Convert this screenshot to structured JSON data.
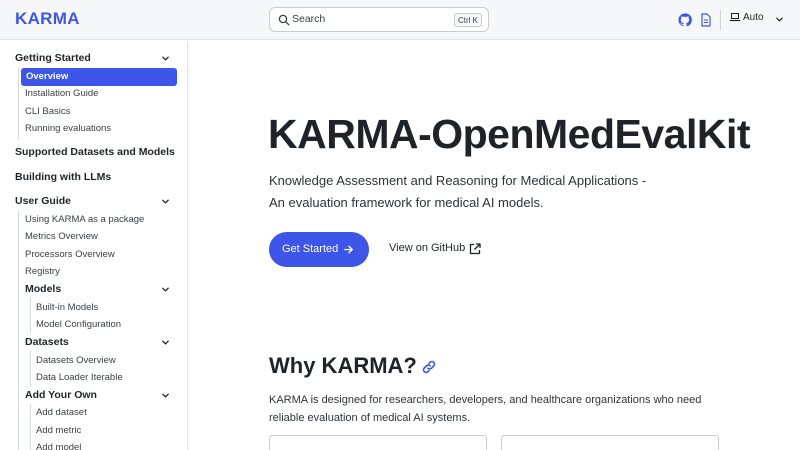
{
  "header": {
    "brand": "KARMA",
    "search_placeholder": "Search",
    "search_shortcut": "Ctrl K",
    "theme_label": "Auto",
    "icons": [
      "search-icon",
      "github-icon",
      "document-icon",
      "laptop-icon",
      "chevron-down-icon"
    ]
  },
  "sidebar": {
    "getting_started": "Getting Started",
    "overview": "Overview",
    "installation_guide": "Installation Guide",
    "cli_basics": "CLI Basics",
    "running_evaluations": "Running evaluations",
    "supported_datasets": "Supported Datasets and Models",
    "building_with_llms": "Building with LLMs",
    "user_guide": "User Guide",
    "using_karma_package": "Using KARMA as a package",
    "metrics_overview": "Metrics Overview",
    "processors_overview": "Processors Overview",
    "registry": "Registry",
    "models": "Models",
    "builtin_models": "Built-in Models",
    "model_configuration": "Model Configuration",
    "datasets": "Datasets",
    "datasets_overview": "Datasets Overview",
    "data_loader_iterable": "Data Loader Iterable",
    "add_your_own": "Add Your Own",
    "add_dataset": "Add dataset",
    "add_metric": "Add metric",
    "add_model": "Add model"
  },
  "hero": {
    "title": "KARMA-OpenMedEvalKit",
    "subtitle_line1": "Knowledge Assessment and Reasoning for Medical Applications -",
    "subtitle_line2": "An evaluation framework for medical AI models.",
    "primary_button": "Get Started",
    "secondary_button": "View on GitHub"
  },
  "why": {
    "heading": "Why KARMA?",
    "text_line1": "KARMA is designed for researchers, developers, and healthcare organizations who need",
    "text_line2": "reliable evaluation of medical AI systems."
  },
  "colors": {
    "accent": "#3d55e8",
    "text": "#1f2328",
    "header_bg": "#f6f7f9",
    "border": "#e3e5e8"
  }
}
